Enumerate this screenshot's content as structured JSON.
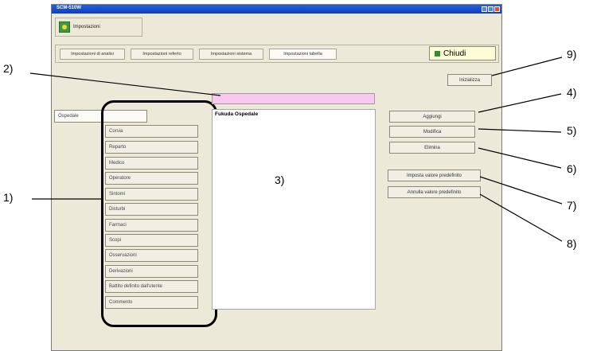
{
  "window": {
    "title": "SCM-510W",
    "header_title": "Impostazioni",
    "close_label": "Chiudi"
  },
  "tabs": [
    {
      "label": "Impostazioni di analisi"
    },
    {
      "label": "Impostazioni referto"
    },
    {
      "label": "Impostazioni sistema"
    },
    {
      "label": "Impostazioni tabella"
    }
  ],
  "categories": [
    {
      "label": "Ospedale"
    },
    {
      "label": "Corsia"
    },
    {
      "label": "Reparto"
    },
    {
      "label": "Medico"
    },
    {
      "label": "Operatore"
    },
    {
      "label": "Sintomi"
    },
    {
      "label": "Disturbi"
    },
    {
      "label": "Farmaci"
    },
    {
      "label": "Scopi"
    },
    {
      "label": "Osservazioni"
    },
    {
      "label": "Derivazioni"
    },
    {
      "label": "Battito definito dall'utente"
    },
    {
      "label": "Commento"
    }
  ],
  "list": {
    "items": [
      "Fukuda Ospedale"
    ]
  },
  "actions": {
    "inizializza": "Inizializza",
    "aggiungi": "Aggiungi",
    "modifica": "Modifica",
    "elimina": "Elimina",
    "imposta_default": "Imposta valore predefinito",
    "annulla_default": "Annulla valore predefinito"
  },
  "callouts": [
    "1)",
    "2)",
    "3)",
    "4)",
    "5)",
    "6)",
    "7)",
    "8)",
    "9)"
  ]
}
